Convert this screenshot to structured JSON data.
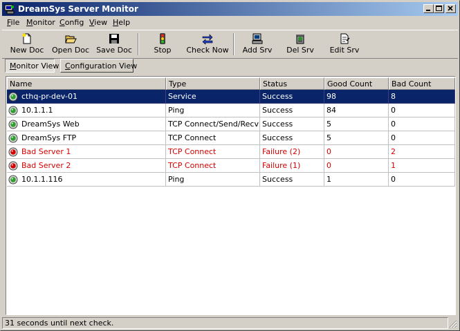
{
  "window": {
    "title": "DreamSys Server Monitor"
  },
  "menu": [
    {
      "key": "F",
      "rest": "ile"
    },
    {
      "key": "M",
      "rest": "onitor"
    },
    {
      "key": "C",
      "rest": "onfig"
    },
    {
      "key": "V",
      "rest": "iew"
    },
    {
      "key": "H",
      "rest": "elp"
    }
  ],
  "toolbar": {
    "new_doc": "New Doc",
    "open_doc": "Open Doc",
    "save_doc": "Save Doc",
    "stop": "Stop",
    "check_now": "Check Now",
    "add_srv": "Add Srv",
    "del_srv": "Del Srv",
    "edit_srv": "Edit Srv"
  },
  "tabs": {
    "monitor": {
      "key": "M",
      "rest": "onitor View"
    },
    "configuration": {
      "key": "C",
      "rest": "onfiguration View"
    }
  },
  "columns": {
    "name": "Name",
    "type": "Type",
    "status": "Status",
    "good": "Good Count",
    "bad": "Bad Count"
  },
  "rows": [
    {
      "name": "cthq-pr-dev-01",
      "type": "Service",
      "status": "Success",
      "good": "98",
      "bad": "8",
      "state": "ok",
      "selected": true
    },
    {
      "name": "10.1.1.1",
      "type": "Ping",
      "status": "Success",
      "good": "84",
      "bad": "0",
      "state": "ok"
    },
    {
      "name": "DreamSys Web",
      "type": "TCP Connect/Send/Recv",
      "status": "Success",
      "good": "5",
      "bad": "0",
      "state": "ok"
    },
    {
      "name": "DreamSys FTP",
      "type": "TCP Connect",
      "status": "Success",
      "good": "5",
      "bad": "0",
      "state": "ok"
    },
    {
      "name": "Bad Server 1",
      "type": "TCP Connect",
      "status": "Failure (2)",
      "good": "0",
      "bad": "2",
      "state": "fail"
    },
    {
      "name": "Bad Server 2",
      "type": "TCP Connect",
      "status": "Failure (1)",
      "good": "0",
      "bad": "1",
      "state": "fail"
    },
    {
      "name": "10.1.1.116",
      "type": "Ping",
      "status": "Success",
      "good": "1",
      "bad": "0",
      "state": "ok"
    }
  ],
  "statusbar": {
    "text": "31 seconds until next check."
  },
  "colors": {
    "ok_light": "#2e9e2e",
    "fail_light": "#d40000",
    "fail_text": "#d40000",
    "selection": "#0a246a"
  },
  "icons": {
    "app": "server-monitor-icon",
    "new_doc": "new-document-icon",
    "open_doc": "open-folder-icon",
    "save_doc": "floppy-disk-icon",
    "stop": "traffic-light-icon",
    "check_now": "arrows-icon",
    "add_srv": "add-computer-icon",
    "del_srv": "trash-can-icon",
    "edit_srv": "edit-document-icon",
    "row_status": "status-light-icon"
  }
}
